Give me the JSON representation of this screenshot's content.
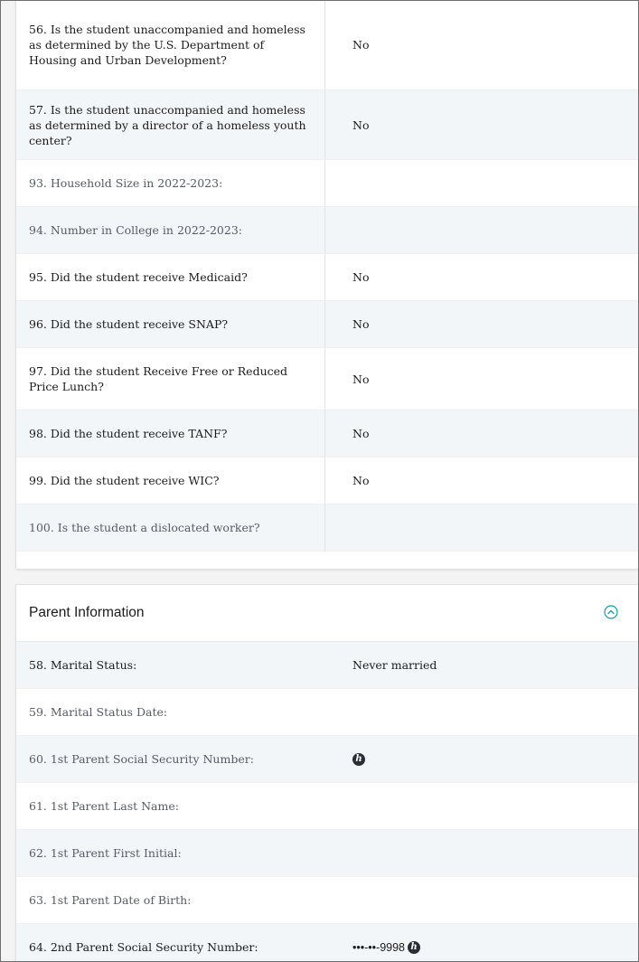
{
  "student_rows": [
    {
      "question": "56. Is the student unaccompanied and homeless as determined by the U.S. Department of Housing and Urban Development?",
      "answer": "No"
    },
    {
      "question": "57. Is the student unaccompanied and homeless as determined by a director of a homeless youth center?",
      "answer": "No"
    },
    {
      "question": "93. Household Size in 2022-2023:",
      "answer": ""
    },
    {
      "question": "94. Number in College in 2022-2023:",
      "answer": ""
    },
    {
      "question": "95. Did the student receive Medicaid?",
      "answer": "No"
    },
    {
      "question": "96. Did the student receive SNAP?",
      "answer": "No"
    },
    {
      "question": "97. Did the student Receive Free or Reduced Price Lunch?",
      "answer": "No"
    },
    {
      "question": "98. Did the student receive TANF?",
      "answer": "No"
    },
    {
      "question": "99. Did the student receive WIC?",
      "answer": "No"
    },
    {
      "question": "100. Is the student a dislocated worker?",
      "answer": ""
    }
  ],
  "parent_section": {
    "title": "Parent Information",
    "collapse_icon": "chevron-up-circle-icon",
    "rows": [
      {
        "question": "58. Marital Status:",
        "answer": "Never married"
      },
      {
        "question": "59. Marital Status Date:",
        "answer": ""
      },
      {
        "question": "60. 1st Parent Social Security Number:",
        "answer": ""
      },
      {
        "question": "61. 1st Parent Last Name:",
        "answer": ""
      },
      {
        "question": "62. 1st Parent First Initial:",
        "answer": ""
      },
      {
        "question": "63. 1st Parent Date of Birth:",
        "answer": ""
      },
      {
        "question": "64. 2nd Parent Social Security Number:",
        "answer": "•••-••-9998"
      }
    ]
  },
  "reveal_badge_glyph": "h",
  "colors": {
    "row_alt": "#f3f6f9",
    "badge": "#2a2f36",
    "accent": "#1a9aa0"
  }
}
